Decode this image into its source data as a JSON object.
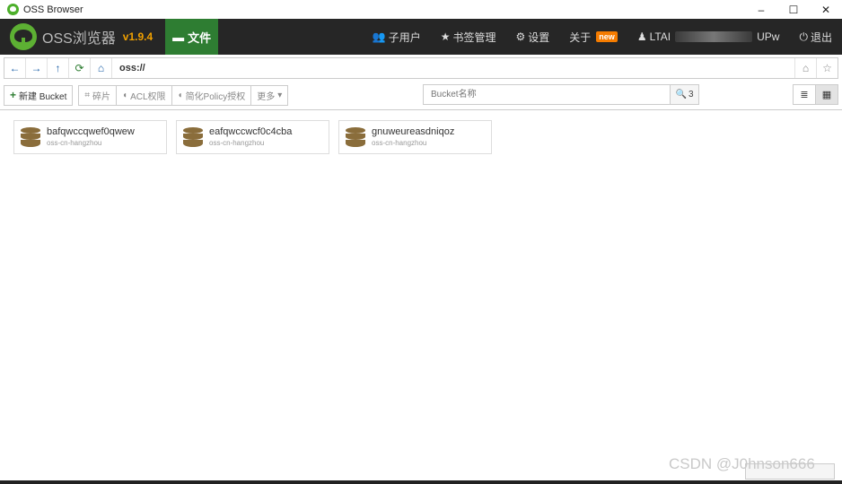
{
  "window": {
    "title": "OSS Browser",
    "controls": {
      "minimize": "–",
      "maximize": "☐",
      "close": "✕"
    }
  },
  "navbar": {
    "brand": "OSS浏览器",
    "version": "v1.9.4",
    "file_tab": "文件",
    "items": {
      "subuser": "子用户",
      "bookmarks": "书签管理",
      "settings": "设置",
      "about": "关于",
      "about_badge": "new",
      "account_prefix": "LTAI",
      "account_suffix": "UPw",
      "logout": "退出"
    }
  },
  "addressbar": {
    "back": "←",
    "forward": "→",
    "up": "↑",
    "refresh": "⟳",
    "home": "⌂",
    "path": "oss://",
    "bookmark_home": "⌂",
    "star": "☆"
  },
  "toolbar": {
    "new_bucket": "新建 Bucket",
    "fragments": "碎片",
    "acl": "ACL权限",
    "policy": "简化Policy授权",
    "more": "更多",
    "search_placeholder": "Bucket名称",
    "search_count": "3",
    "list_view_icon": "≣",
    "grid_view_icon": "▦"
  },
  "buckets": [
    {
      "name": "bafqwccqwef0qwew",
      "region": "oss-cn-hangzhou"
    },
    {
      "name": "eafqwccwcf0c4cba",
      "region": "oss-cn-hangzhou"
    },
    {
      "name": "gnuweureasdniqoz",
      "region": "oss-cn-hangzhou"
    }
  ],
  "watermark": "CSDN @J0hnson666",
  "colors": {
    "nav_bg": "#262626",
    "accent_green": "#2e7d32",
    "version_orange": "#f0a000",
    "bucket_icon": "#8a6d3b"
  }
}
